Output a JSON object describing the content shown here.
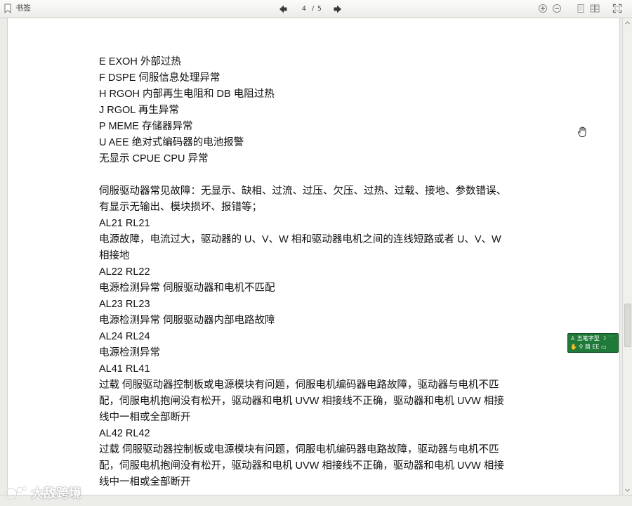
{
  "toolbar": {
    "bookmark_label": "书签",
    "current_page": "4",
    "page_separator": "/",
    "total_pages": "5"
  },
  "document": {
    "lines": [
      "E EXOH  外部过热",
      "F DSPE  伺服信息处理异常",
      "H RGOH  内部再生电阻和 DB 电阻过热",
      "J RGOL  再生异常",
      "P MEME  存储器异常",
      "U AEE  绝对式编码器的电池报警",
      "无显示  CPUE CPU 异常",
      "伺服驱动器常见故障：无显示、缺相、过流、过压、欠压、过热、过载、接地、参数错误、",
      "有显示无输出、模块损坏、报错等；",
      "AL21 RL21",
      "电源故障，电流过大，驱动器的 U、V、W 相和驱动器电机之间的连线短路或者 U、V、W",
      "相接地",
      "AL22 RL22",
      "电源检测异常  伺服驱动器和电机不匹配",
      "AL23 RL23",
      "电源检测异常  伺服驱动器内部电路故障",
      "AL24 RL24",
      "电源检测异常",
      "AL41 RL41",
      "过载  伺服驱动器控制板或电源模块有问题，伺服电机编码器电路故障，驱动器与电机不匹",
      "配，伺服电机抱闸没有松开，驱动器和电机 UVW 相接线不正确，驱动器和电机 UVW 相接",
      "线中一相或全部断开",
      "AL42 RL42",
      "过载  伺服驱动器控制板或电源模块有问题，伺服电机编码器电路故障，驱动器与电机不匹",
      "配，伺服电机抱闸没有松开，驱动器和电机 UVW 相接线不正确，驱动器和电机 UVW 相接",
      "线中一相或全部断开"
    ]
  },
  "ime": {
    "row1": "五笔字型",
    "row2": "简 EE"
  },
  "watermark": {
    "text": "大敌跨境"
  },
  "icons": {
    "bookmark": "bookmark-icon",
    "prev": "prev-page-icon",
    "next": "next-page-icon",
    "zoom_in": "zoom-in-icon",
    "zoom_out": "zoom-out-icon",
    "single_page": "single-page-icon",
    "two_page": "two-page-icon",
    "fullscreen": "fullscreen-icon",
    "hand": "hand-cursor-icon"
  },
  "colors": {
    "nav_arrow": "#3a3a3a",
    "ime_bg": "#1f7a3a",
    "text": "#111111"
  }
}
